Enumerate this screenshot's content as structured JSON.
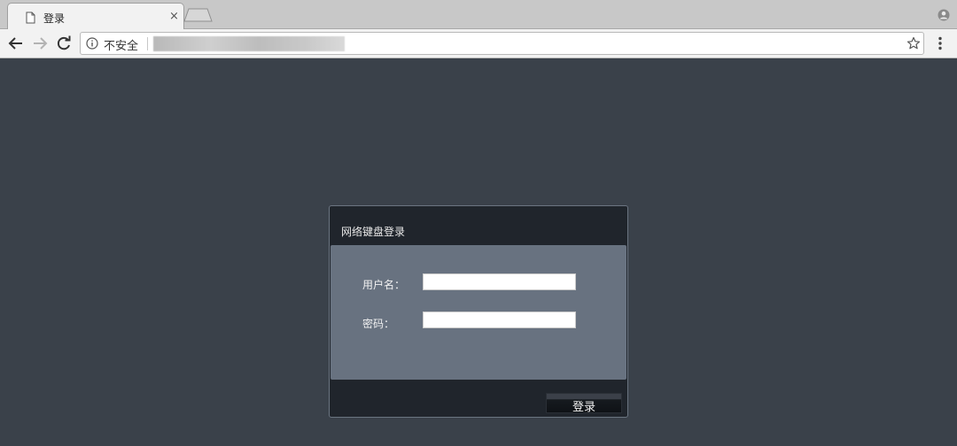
{
  "browser": {
    "tab": {
      "title": "登录",
      "close_glyph": "×",
      "icon": "document-icon"
    },
    "toolbar": {
      "security_label": "不安全",
      "url": ""
    }
  },
  "dialog": {
    "title": "网络键盘登录",
    "fields": {
      "username": {
        "label": "用户名：",
        "value": ""
      },
      "password": {
        "label": "密码：",
        "value": ""
      }
    },
    "submit_label": "登录"
  },
  "colors": {
    "page_bg": "#3a414a",
    "dialog_bg": "#20252c",
    "dialog_body_bg": "#687280"
  }
}
